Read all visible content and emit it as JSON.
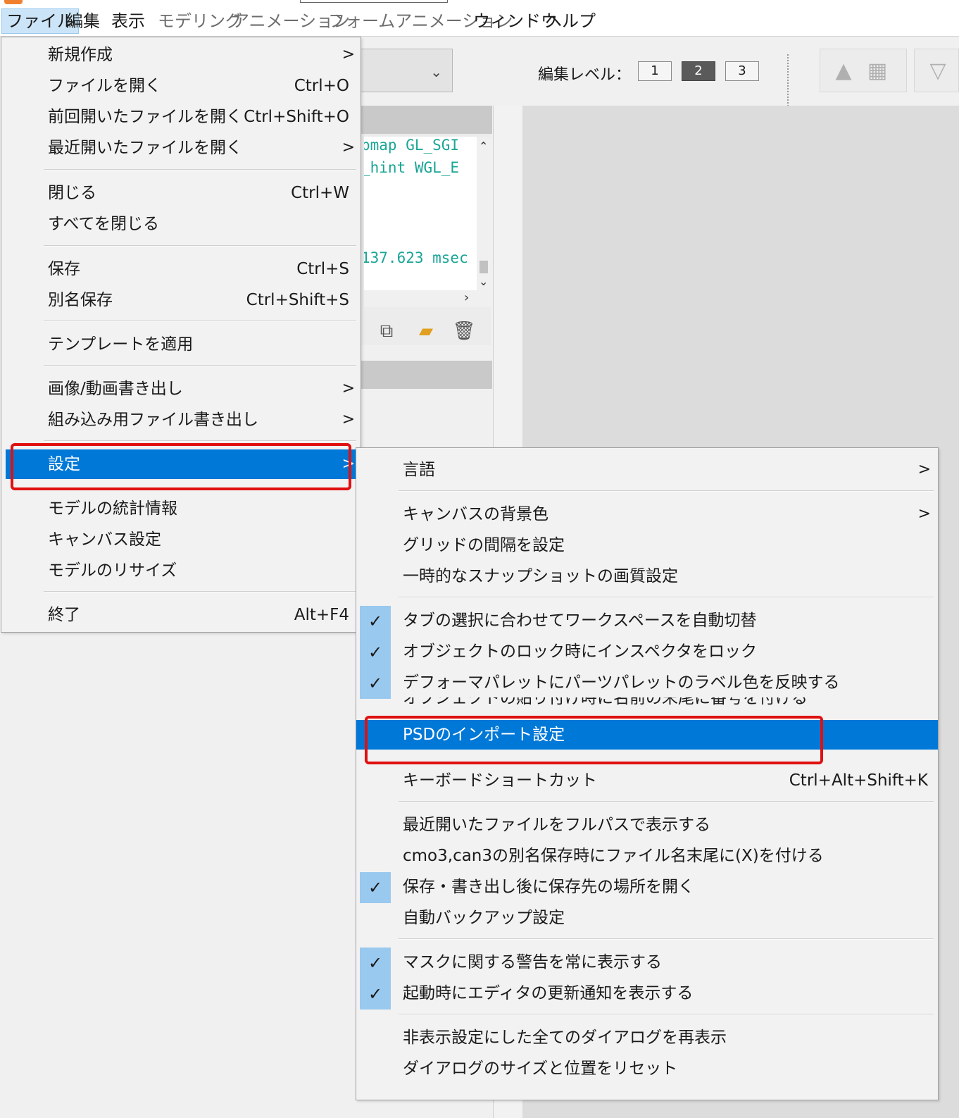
{
  "menubar": {
    "items": [
      {
        "label": "ファイル"
      },
      {
        "label": "編集"
      },
      {
        "label": "表示"
      },
      {
        "label": "モデリング"
      },
      {
        "label": "アニメーション"
      },
      {
        "label": "フォームアニメーション"
      },
      {
        "label": "ウィンドウ"
      },
      {
        "label": "ヘルプ"
      }
    ]
  },
  "toolbar": {
    "edit_level_label": "編集レベル：",
    "levels": [
      "1",
      "2",
      "3"
    ],
    "selected_level": "2"
  },
  "log": {
    "lines": [
      "pmap GL_SGI",
      "_hint WGL_E",
      "137.623 msec"
    ]
  },
  "file_menu": {
    "items": [
      {
        "label": "新規作成",
        "shortcut": "",
        "submenu": true
      },
      {
        "label": "ファイルを開く",
        "shortcut": "Ctrl+O"
      },
      {
        "label": "前回開いたファイルを開く",
        "shortcut": "Ctrl+Shift+O"
      },
      {
        "label": "最近開いたファイルを開く",
        "shortcut": "",
        "submenu": true
      },
      {
        "label": "閉じる",
        "shortcut": "Ctrl+W"
      },
      {
        "label": "すべてを閉じる",
        "shortcut": ""
      },
      {
        "label": "保存",
        "shortcut": "Ctrl+S"
      },
      {
        "label": "別名保存",
        "shortcut": "Ctrl+Shift+S"
      },
      {
        "label": "テンプレートを適用",
        "shortcut": ""
      },
      {
        "label": "画像/動画書き出し",
        "shortcut": "",
        "submenu": true
      },
      {
        "label": "組み込み用ファイル書き出し",
        "shortcut": "",
        "submenu": true
      },
      {
        "label": "設定",
        "shortcut": "",
        "submenu": true,
        "highlighted": true
      },
      {
        "label": "モデルの統計情報",
        "shortcut": ""
      },
      {
        "label": "キャンバス設定",
        "shortcut": ""
      },
      {
        "label": "モデルのリサイズ",
        "shortcut": ""
      },
      {
        "label": "終了",
        "shortcut": "Alt+F4"
      }
    ],
    "arrow": ">"
  },
  "settings_menu": {
    "items": [
      {
        "label": "言語",
        "submenu": true
      },
      {
        "label": "キャンバスの背景色",
        "submenu": true
      },
      {
        "label": "グリッドの間隔を設定"
      },
      {
        "label": "一時的なスナップショットの画質設定"
      },
      {
        "label": "タブの選択に合わせてワークスペースを自動切替",
        "checked": true
      },
      {
        "label": "オブジェクトのロック時にインスペクタをロック",
        "checked": true
      },
      {
        "label": "デフォーマパレットにパーツパレットのラベル色を反映する",
        "checked": true
      },
      {
        "label": "オブジェクトの貼り付け時に名前の末尾に番号を付ける"
      },
      {
        "label": "PSDのインポート設定",
        "highlighted": true
      },
      {
        "label": "キーボードショートカット",
        "shortcut": "Ctrl+Alt+Shift+K"
      },
      {
        "label": "最近開いたファイルをフルパスで表示する"
      },
      {
        "label": "cmo3,can3の別名保存時にファイル名末尾に(X)を付ける"
      },
      {
        "label": "保存・書き出し後に保存先の場所を開く",
        "checked": true
      },
      {
        "label": "自動バックアップ設定"
      },
      {
        "label": "マスクに関する警告を常に表示する",
        "checked": true
      },
      {
        "label": "起動時にエディタの更新通知を表示する",
        "checked": true
      },
      {
        "label": "非表示設定にした全てのダイアログを再表示"
      },
      {
        "label": "ダイアログのサイズと位置をリセット"
      }
    ],
    "check_glyph": "✓",
    "arrow": ">"
  },
  "colors": {
    "highlight": "#0078d7",
    "check_bg": "#99c9ef",
    "annotation_red": "#e01010",
    "log_text": "#1aa596"
  }
}
